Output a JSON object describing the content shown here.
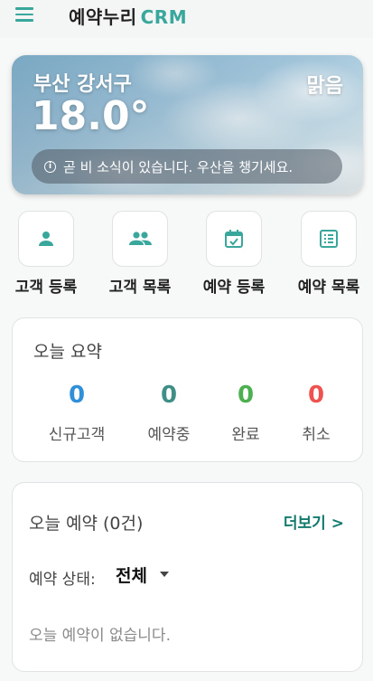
{
  "app": {
    "title": "예약누리",
    "title_accent": "CRM",
    "accent_color": "#3aa79c"
  },
  "weather": {
    "city": "부산 강서구",
    "condition": "맑음",
    "temperature": "18.0°",
    "alert": "곧 비 소식이 있습니다. 우산을 챙기세요."
  },
  "actions": [
    {
      "label": "고객 등록",
      "icon": "person-icon"
    },
    {
      "label": "고객 목록",
      "icon": "people-icon"
    },
    {
      "label": "예약 등록",
      "icon": "calendar-check-icon"
    },
    {
      "label": "예약 목록",
      "icon": "list-icon"
    }
  ],
  "summary": {
    "title": "오늘 요약",
    "stats": [
      {
        "value": "0",
        "label": "신규고객",
        "color": "#2f8fd8"
      },
      {
        "value": "0",
        "label": "예약중",
        "color": "#3f8f87"
      },
      {
        "value": "0",
        "label": "완료",
        "color": "#4caf50"
      },
      {
        "value": "0",
        "label": "취소",
        "color": "#ef5350"
      }
    ]
  },
  "today": {
    "title": "오늘 예약 (0건)",
    "more": "더보기 >",
    "filter_label": "예약 상태:",
    "filter_value": "전체",
    "empty": "오늘 예약이 없습니다."
  }
}
